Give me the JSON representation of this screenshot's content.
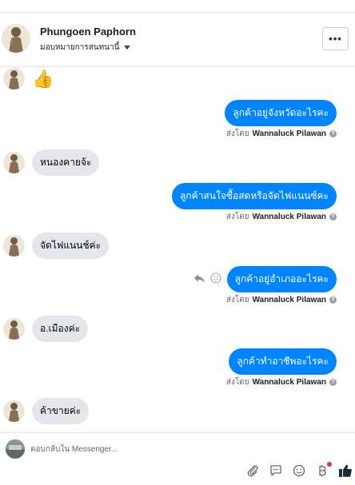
{
  "header": {
    "name": "Phungoen Paphorn",
    "subtitle": "มอบหมายการสนทนานี้",
    "more_label": "•••"
  },
  "conversation": {
    "messages": [
      {
        "direction": "in",
        "text": "👍"
      },
      {
        "direction": "out",
        "text": "ลูกค้าอยู่จังหวัดอะไรคะ",
        "sent_by_prefix": "ส่งโดย",
        "sent_by": "Wannaluck Pilawan"
      },
      {
        "direction": "in",
        "text": "หนองคายจ้ะ"
      },
      {
        "direction": "out",
        "text": "ลูกค้าสนใจซื้อสดหรือจัดไฟแนนซ์คะ",
        "sent_by_prefix": "ส่งโดย",
        "sent_by": "Wannaluck Pilawan"
      },
      {
        "direction": "in",
        "text": "จัดไฟแนนช์ค่ะ"
      },
      {
        "direction": "out",
        "text": "ลูกค้าอยู่อำเภออะไรคะ",
        "sent_by_prefix": "ส่งโดย",
        "sent_by": "Wannaluck Pilawan"
      },
      {
        "direction": "in",
        "text": "อ.เมืองค่ะ"
      },
      {
        "direction": "out",
        "text": "ลูกค้าทำอาชีพอะไรคะ",
        "sent_by_prefix": "ส่งโดย",
        "sent_by": "Wannaluck Pilawan"
      },
      {
        "direction": "in",
        "text": "ค้าขายค่ะ"
      }
    ]
  },
  "composer": {
    "placeholder": "ตอบกลับใน Messenger...",
    "value": ""
  },
  "colors": {
    "outgoing_bubble": "#0084ff",
    "incoming_bubble": "#e4e6eb",
    "like": "#1c2b33",
    "notification_dot": "#f02849"
  }
}
